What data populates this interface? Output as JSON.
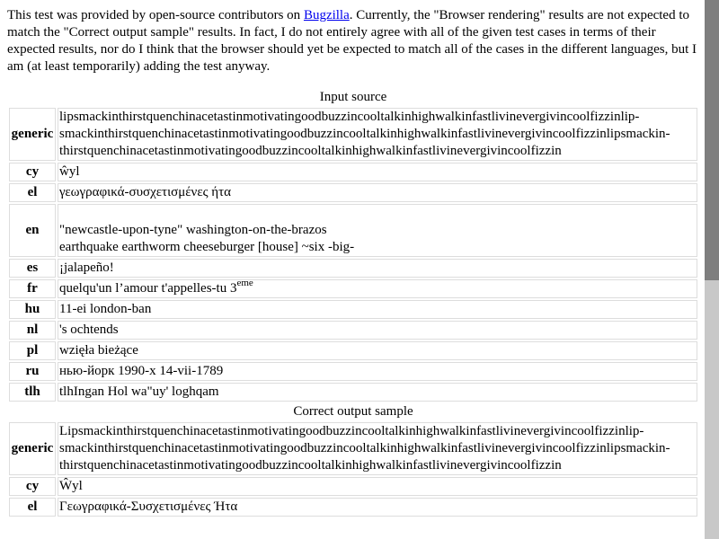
{
  "intro": {
    "text_before_link": "This test was provided by open-source contributors on ",
    "link_label": "Bugzilla",
    "text_after_link": ". Currently, the \"Browser rendering\" results are not expected to match the \"Correct output sample\" results. In fact, I do not entirely agree with all of the given test cases in terms of their expected results, nor do I think that the browser should yet be expected to match all of the cases in the different languages, but I am (at least temporarily) adding the test anyway."
  },
  "input_source": {
    "caption": "Input source",
    "rows": {
      "generic": {
        "lang": "generic",
        "line1": "lipsmackinthirstquenchinacetastinmotivatingoodbuzzincooltalkinhighwalkinfastlivinevergivincoolfizzinlip-",
        "line2": "smackinthirstquenchinacetastinmotivatingoodbuzzincooltalkinhighwalkinfastlivinevergivincoolfizzinlipsmackin-",
        "line3": "thirstquenchinacetastinmotivatingoodbuzzincooltalkinhighwalkinfastlivinevergivincoolfizzin"
      },
      "cy": {
        "lang": "cy",
        "text": "ŵyl"
      },
      "el": {
        "lang": "el",
        "text": "γεωγραφικά-συσχετισμένες ήτα"
      },
      "en": {
        "lang": "en",
        "line1": "\"newcastle-upon-tyne\" washington-on-the-brazos",
        "line2": "earthquake earthworm cheeseburger [house] ~six -big-"
      },
      "es": {
        "lang": "es",
        "text": "¡jalapeño!"
      },
      "fr": {
        "lang": "fr",
        "text": "quelqu'un l’amour t'appelles-tu 3",
        "sup": "eme"
      },
      "hu": {
        "lang": "hu",
        "text": "11-ei london-ban"
      },
      "nl": {
        "lang": "nl",
        "text": "'s ochtends"
      },
      "pl": {
        "lang": "pl",
        "text": "wzięła bieżące"
      },
      "ru": {
        "lang": "ru",
        "text": "нью-йорк 1990-х 14-vii-1789"
      },
      "tlh": {
        "lang": "tlh",
        "text": "tlhIngan Hol wa\"uy' loghqam"
      }
    }
  },
  "correct_output": {
    "caption": "Correct output sample",
    "rows": {
      "generic": {
        "lang": "generic",
        "line1": "Lipsmackinthirstquenchinacetastinmotivatingoodbuzzincooltalkinhighwalkinfastlivinevergivincoolfizzinlip-",
        "line2": "smackinthirstquenchinacetastinmotivatingoodbuzzincooltalkinhighwalkinfastlivinevergivincoolfizzinlipsmackin-",
        "line3": "thirstquenchinacetastinmotivatingoodbuzzincooltalkinhighwalkinfastlivinevergivincoolfizzin"
      },
      "cy": {
        "lang": "cy",
        "text": "Ŵyl"
      },
      "el": {
        "lang": "el",
        "text": "Γεωγραφικά-Συσχετισμένες Ήτα"
      }
    }
  }
}
